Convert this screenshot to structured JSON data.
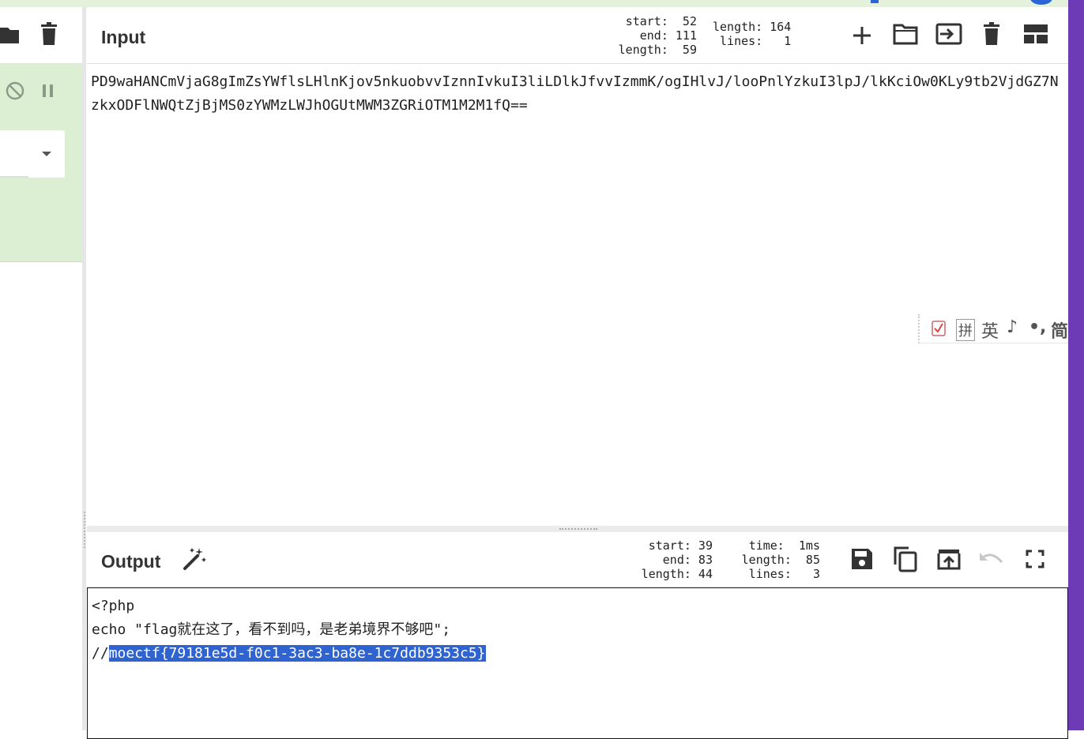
{
  "colors": {
    "accent_purple": "#6d3bb5",
    "recipe_green": "#dcefd3",
    "selection_blue": "#2f63d0",
    "top_circle_blue": "#2a64d6"
  },
  "icons": {
    "left_header": [
      "folder-icon",
      "trash-icon"
    ],
    "left_controls": [
      "disable-icon",
      "pause-icon"
    ],
    "input_header": [
      "plus-icon",
      "open-folder-icon",
      "load-file-icon",
      "trash-icon",
      "layout-icon"
    ],
    "output_header": [
      "save-icon",
      "copy-icon",
      "replace-input-icon",
      "undo-icon",
      "fullscreen-icon"
    ],
    "output_title": "magic-wand-icon"
  },
  "input": {
    "title": "Input",
    "stats_left": "start:  52\n  end: 111\nlength:  59",
    "stats_right": "length: 164\n lines:   1",
    "text": "PD9waHANCmVjaG8gImZsYWflsLHlnKjov5nkuobvvIznnIvkuI3liLDlkJfvvIzmmK/ogIHlvJ/looPnlYzkuI3lpJ/lkKciOw0KLy9tb2VjdGZ7NzkxODFlNWQtZjBjMS0zYWMzLWJhOGUtMWM3ZGRiOTM1M2M1fQ=="
  },
  "ime_toolbar": {
    "items": [
      "拼",
      "英",
      "♪",
      "•,",
      "简"
    ]
  },
  "output": {
    "title": "Output",
    "stats_left": "start: 39\n  end: 83\nlength: 44",
    "stats_right": "time:  1ms\nlength:  85\n lines:   3",
    "line1": "<?php",
    "line2": "echo \"flag就在这了，看不到吗，是老弟境界不够吧\";",
    "line3_prefix": "//",
    "line3_selected": "moectf{79181e5d-f0c1-3ac3-ba8e-1c7ddb9353c5}"
  }
}
